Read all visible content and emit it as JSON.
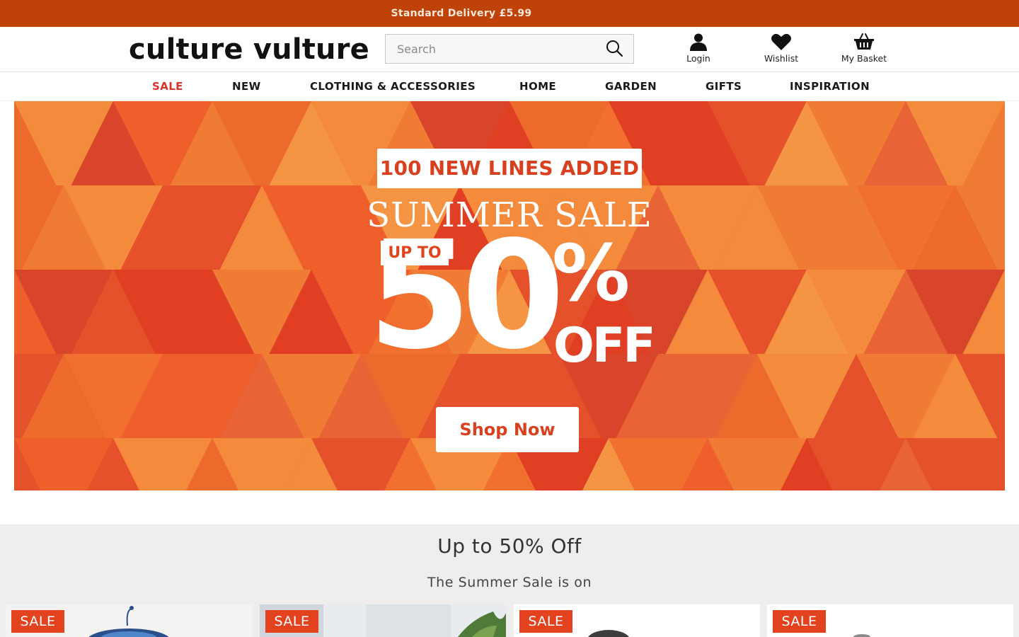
{
  "announcement": {
    "text": "Standard Delivery £5.99"
  },
  "header": {
    "logo": "culture vulture",
    "search": {
      "placeholder": "Search",
      "value": ""
    },
    "actions": [
      {
        "label": "Login",
        "icon": "user-icon"
      },
      {
        "label": "Wishlist",
        "icon": "heart-icon"
      },
      {
        "label": "My Basket",
        "icon": "basket-icon"
      }
    ]
  },
  "nav": {
    "items": [
      {
        "label": "SALE",
        "highlight": "#d4352c"
      },
      {
        "label": "NEW"
      },
      {
        "label": "CLOTHING & ACCESSORIES"
      },
      {
        "label": "HOME"
      },
      {
        "label": "GARDEN"
      },
      {
        "label": "GIFTS"
      },
      {
        "label": "INSPIRATION"
      }
    ]
  },
  "hero": {
    "badge": "100 NEW LINES ADDED",
    "title": "SUMMER SALE",
    "up_to": "UP TO",
    "amount": "50",
    "percent": "%",
    "off": "OFF",
    "cta": "Shop Now",
    "accent": "#e85a23"
  },
  "sale_section": {
    "heading": "Up to 50% Off",
    "subheading": "The Summer Sale is on",
    "cards": [
      {
        "badge": "SALE"
      },
      {
        "badge": "SALE"
      },
      {
        "badge": "SALE"
      },
      {
        "badge": "SALE"
      }
    ]
  },
  "colors": {
    "topbar": "#bf4208",
    "sale_badge": "#e3421f",
    "section_bg": "#f0eeec"
  }
}
